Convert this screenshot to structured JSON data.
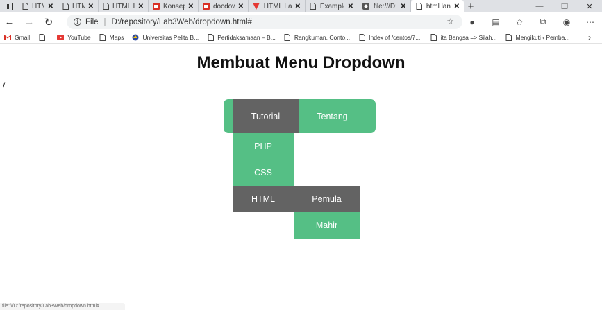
{
  "browser": {
    "tabs": [
      {
        "title": "HTML La",
        "icon": "page-icon"
      },
      {
        "title": "HTML La",
        "icon": "page-icon"
      },
      {
        "title": "HTML La",
        "icon": "page-icon"
      },
      {
        "title": "Konsep_",
        "icon": "pdf-icon"
      },
      {
        "title": "docdow",
        "icon": "pdf-icon"
      },
      {
        "title": "HTML La",
        "icon": "brand-v-icon"
      },
      {
        "title": "Example",
        "icon": "page-icon"
      },
      {
        "title": "file:///D:",
        "icon": "file-icon"
      },
      {
        "title": "html lan",
        "icon": "page-icon",
        "active": true
      }
    ],
    "new_tab": "+",
    "address": {
      "scheme_label": "File",
      "url": "D:/repository/Lab3Web/dropdown.html#"
    },
    "bookmarks": [
      {
        "label": "Gmail",
        "icon": "gmail-icon"
      },
      {
        "label": "",
        "icon": "page-icon"
      },
      {
        "label": "YouTube",
        "icon": "youtube-icon"
      },
      {
        "label": "Maps",
        "icon": "page-icon"
      },
      {
        "label": "Universitas Pelita B...",
        "icon": "university-icon"
      },
      {
        "label": "Pertidaksamaan – B...",
        "icon": "page-icon"
      },
      {
        "label": "Rangkuman, Conto...",
        "icon": "page-icon"
      },
      {
        "label": "Index of /centos/7....",
        "icon": "page-icon"
      },
      {
        "label": "ita Bangsa => Silah...",
        "icon": "page-icon"
      },
      {
        "label": "Mengikuti ‹ Pemba...",
        "icon": "page-icon"
      }
    ],
    "status_text": "file:///D:/repository/Lab3Web/dropdown.html#"
  },
  "page": {
    "heading": "Membuat Menu Dropdown",
    "stray_text": "/",
    "menu": {
      "tutorial": "Tutorial",
      "tentang": "Tentang",
      "php": "PHP",
      "css": "CSS",
      "html": "HTML",
      "pemula": "Pemula",
      "mahir": "Mahir"
    }
  },
  "colors": {
    "menu_green": "#55bf85",
    "menu_dark": "#636363",
    "menu_text": "#ffffff"
  }
}
